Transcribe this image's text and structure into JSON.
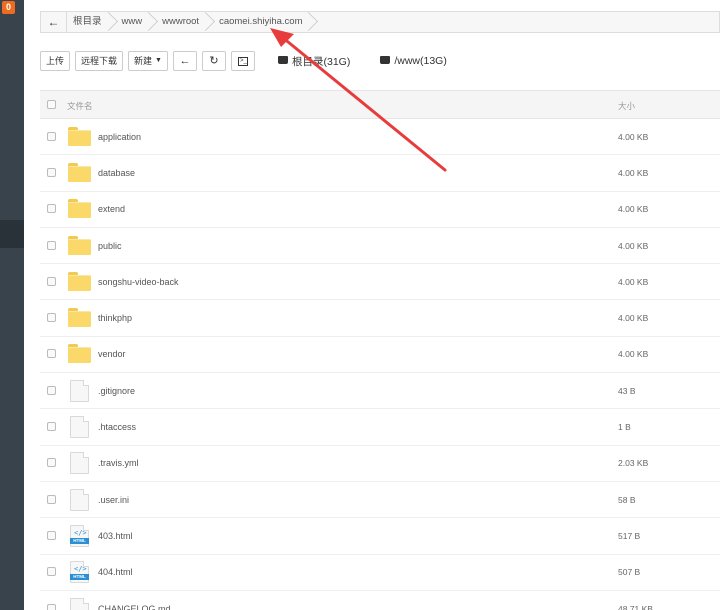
{
  "sidebar": {
    "badge": "0"
  },
  "breadcrumb": {
    "items": [
      "根目录",
      "www",
      "wwwroot",
      "caomei.shiyiha.com"
    ]
  },
  "toolbar": {
    "upload": "上传",
    "remote_download": "远程下载",
    "new": "新建",
    "disks": [
      {
        "label": "根目录(31G)"
      },
      {
        "label": "/www(13G)"
      }
    ]
  },
  "table": {
    "header_name": "文件名",
    "header_size": "大小",
    "rows": [
      {
        "name": "application",
        "size": "4.00 KB",
        "type": "folder"
      },
      {
        "name": "database",
        "size": "4.00 KB",
        "type": "folder"
      },
      {
        "name": "extend",
        "size": "4.00 KB",
        "type": "folder"
      },
      {
        "name": "public",
        "size": "4.00 KB",
        "type": "folder"
      },
      {
        "name": "songshu-video-back",
        "size": "4.00 KB",
        "type": "folder"
      },
      {
        "name": "thinkphp",
        "size": "4.00 KB",
        "type": "folder"
      },
      {
        "name": "vendor",
        "size": "4.00 KB",
        "type": "folder"
      },
      {
        "name": ".gitignore",
        "size": "43 B",
        "type": "file"
      },
      {
        "name": ".htaccess",
        "size": "1 B",
        "type": "file"
      },
      {
        "name": ".travis.yml",
        "size": "2.03 KB",
        "type": "file"
      },
      {
        "name": ".user.ini",
        "size": "58 B",
        "type": "file"
      },
      {
        "name": "403.html",
        "size": "517 B",
        "type": "html"
      },
      {
        "name": "404.html",
        "size": "507 B",
        "type": "html"
      },
      {
        "name": "CHANGELOG.md",
        "size": "48.71 KB",
        "type": "file"
      }
    ]
  },
  "colors": {
    "annotation_arrow": "#e83c3c",
    "folder": "#fbd86a",
    "badge": "#ef6b1f"
  }
}
